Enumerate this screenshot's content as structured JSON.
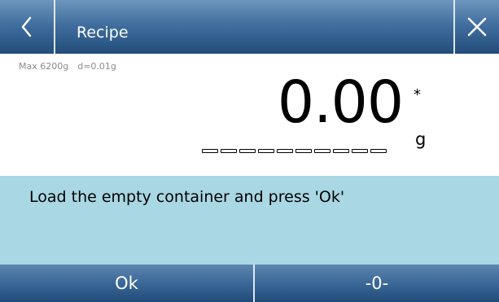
{
  "header": {
    "title": "Recipe",
    "back_icon": "chevron-left-icon",
    "close_icon": "close-icon"
  },
  "scale": {
    "max_capacity": "Max 6200g",
    "division": "d=0.01g",
    "reading": "0.00",
    "stability_mark": "*",
    "unit": "g",
    "bargraph_level": 0
  },
  "message": {
    "text": "Load the empty container and press 'Ok'"
  },
  "footer": {
    "ok_label": "Ok",
    "zero_label": "-0-"
  },
  "colors": {
    "header_bar": "#416f9f",
    "message_panel": "#a9d7e3",
    "footer_bar": "#3b6898"
  }
}
